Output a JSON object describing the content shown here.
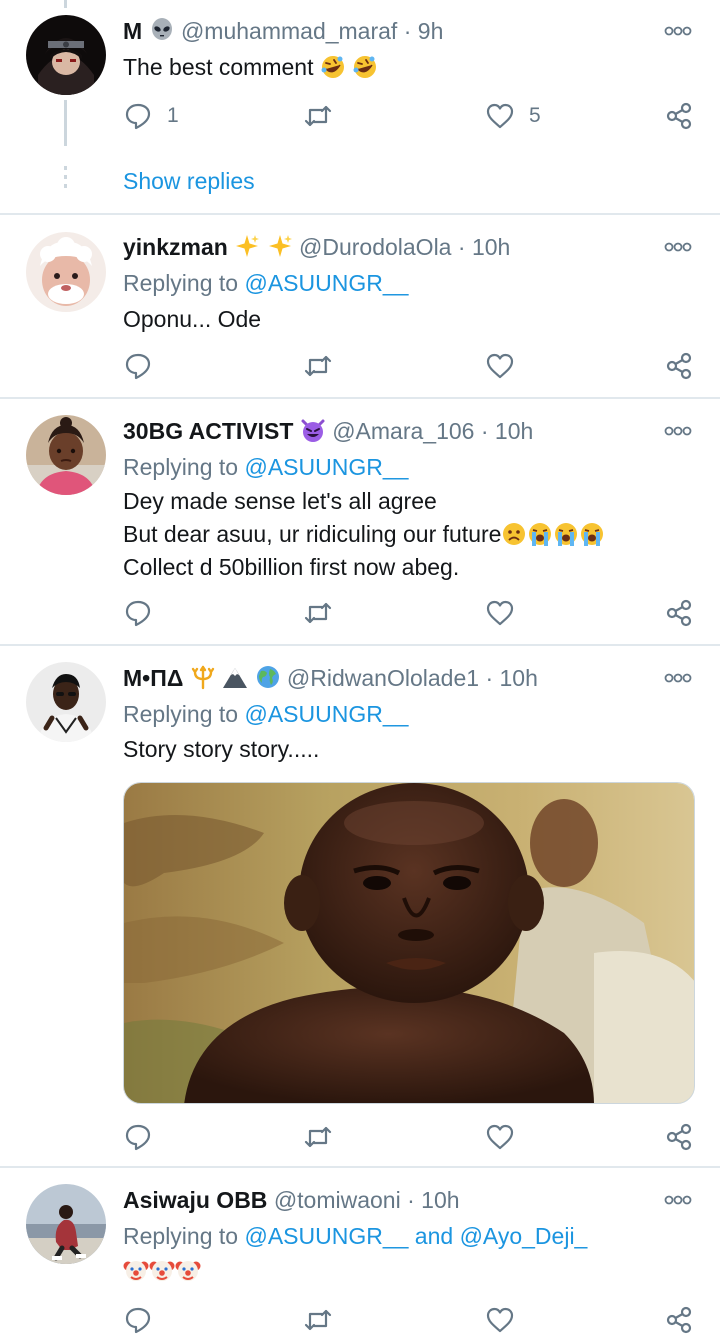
{
  "tweets": [
    {
      "name": "M",
      "name_emojis": [
        "alien"
      ],
      "handle": "@muhammad_maraf",
      "time": "9h",
      "replying_prefix": "",
      "replying_to": "",
      "lines": [
        "The best comment"
      ],
      "line_emojis": [
        [
          "rofl",
          "rofl"
        ]
      ],
      "reply_count": "1",
      "retweet_count": "",
      "like_count": "5"
    },
    {
      "name": "yinkzman",
      "name_emojis": [
        "sparkles",
        "sparkles"
      ],
      "handle": "@DurodolaOla",
      "time": "10h",
      "replying_prefix": "Replying to ",
      "replying_to": "@ASUUNGR__",
      "lines": [
        "Oponu... Ode"
      ],
      "reply_count": "",
      "retweet_count": "",
      "like_count": ""
    },
    {
      "name": "30BG ACTIVIST",
      "name_emojis": [
        "smiling-imp"
      ],
      "handle": "@Amara_106",
      "time": "10h",
      "replying_prefix": "Replying to ",
      "replying_to": "@ASUUNGR__",
      "lines": [
        "Dey made sense let's all agree",
        "But dear asuu, ur ridiculing our future",
        "Collect d 50billion first now abeg."
      ],
      "line_emojis": [
        [],
        [
          "worried",
          "loudly-crying",
          "loudly-crying",
          "loudly-crying"
        ],
        []
      ],
      "reply_count": "",
      "retweet_count": "",
      "like_count": ""
    },
    {
      "name": "M•ΠΔ",
      "name_emojis": [
        "trident",
        "mountain",
        "globe"
      ],
      "handle": "@RidwanOlolade1",
      "time": "10h",
      "replying_prefix": "Replying to ",
      "replying_to": "@ASUUNGR__",
      "lines": [
        "Story story story....."
      ],
      "has_media": true,
      "reply_count": "",
      "retweet_count": "",
      "like_count": ""
    },
    {
      "name": "Asiwaju OBB",
      "name_emojis": [],
      "handle": "@tomiwaoni",
      "time": "10h",
      "replying_prefix": "Replying to ",
      "replying_to": "@ASUUNGR__",
      "replying_and": " and ",
      "replying_to_2": "@Ayo_Deji_",
      "lines": [
        ""
      ],
      "line_emojis": [
        [
          "clown",
          "clown",
          "clown"
        ]
      ],
      "reply_count": "",
      "retweet_count": "",
      "like_count": ""
    }
  ],
  "show_replies": "Show replies",
  "separator": "·",
  "icons": {
    "reply": "reply-icon",
    "retweet": "retweet-icon",
    "like": "heart-icon",
    "share": "share-icon",
    "more": "more-icon"
  },
  "colors": {
    "accent": "#1b95e0",
    "muted": "#657786",
    "text": "#14171a",
    "divider": "#e1e8ed"
  }
}
